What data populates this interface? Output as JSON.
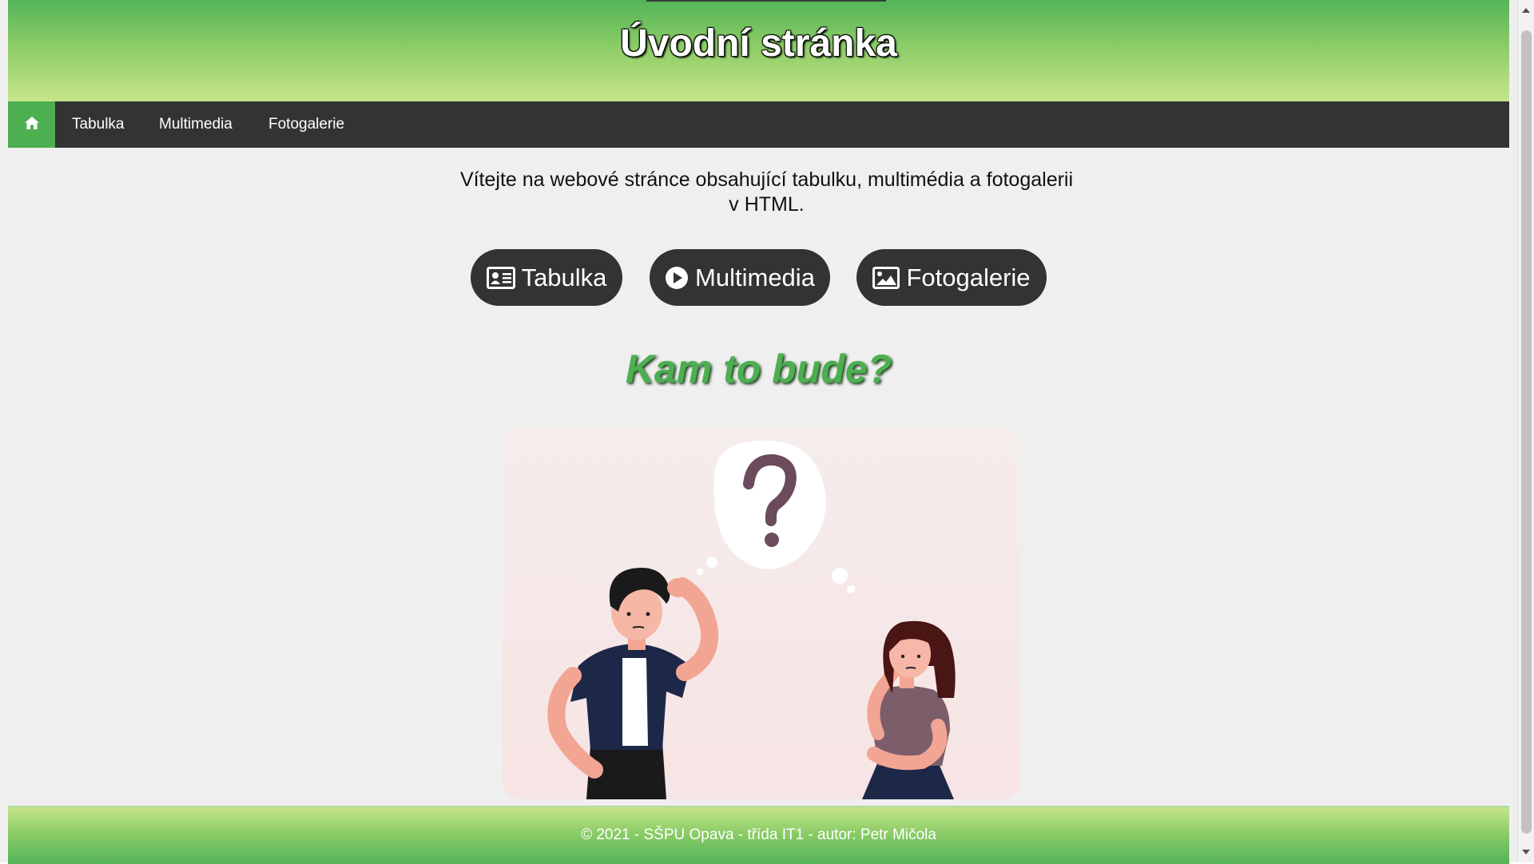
{
  "header": {
    "title": "Úvodní stránka"
  },
  "nav": {
    "home_icon": "home-icon",
    "items": [
      {
        "label": "Tabulka"
      },
      {
        "label": "Multimedia"
      },
      {
        "label": "Fotogalerie"
      }
    ]
  },
  "main": {
    "intro": "Vítejte na webové stránce obsahující tabulku, multimédia a fotogalerii v HTML.",
    "buttons": [
      {
        "label": "Tabulka",
        "icon": "id-card-icon"
      },
      {
        "label": "Multimedia",
        "icon": "play-circle-icon"
      },
      {
        "label": "Fotogalerie",
        "icon": "image-icon"
      }
    ],
    "question": "Kam to bude?"
  },
  "footer": {
    "text": "© 2021 - SŠPU Opava - třída IT1 - autor: Petr Mičola"
  },
  "colors": {
    "accent_green": "#4caf50",
    "nav_dark": "#333333",
    "page_bg": "#efefef"
  }
}
